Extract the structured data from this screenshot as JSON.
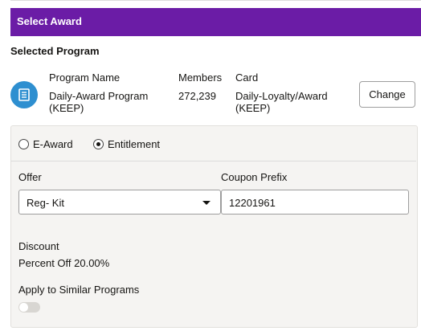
{
  "header": {
    "title": "Select Award"
  },
  "selected_program": {
    "title": "Selected Program",
    "icon": "document-icon",
    "columns": {
      "program_name": "Program Name",
      "members": "Members",
      "card": "Card"
    },
    "program_name_line1": "Daily-Award Program",
    "program_name_line2": "(KEEP)",
    "members": "272,239",
    "card_line1": "Daily-Loyalty/Award",
    "card_line2": "(KEEP)",
    "change_label": "Change"
  },
  "award_type": {
    "options": [
      "E-Award",
      "Entitlement"
    ],
    "selected": "Entitlement"
  },
  "offer": {
    "label": "Offer",
    "value": "Reg- Kit"
  },
  "coupon_prefix": {
    "label": "Coupon Prefix",
    "value": "12201961"
  },
  "discount": {
    "label": "Discount",
    "value": "Percent Off 20.00%"
  },
  "apply_similar": {
    "label": "Apply to Similar Programs",
    "enabled": false
  },
  "colors": {
    "header_bg": "#6b1ca6",
    "icon_bg": "#2e8fd0",
    "panel_bg": "#f5f4f2"
  }
}
